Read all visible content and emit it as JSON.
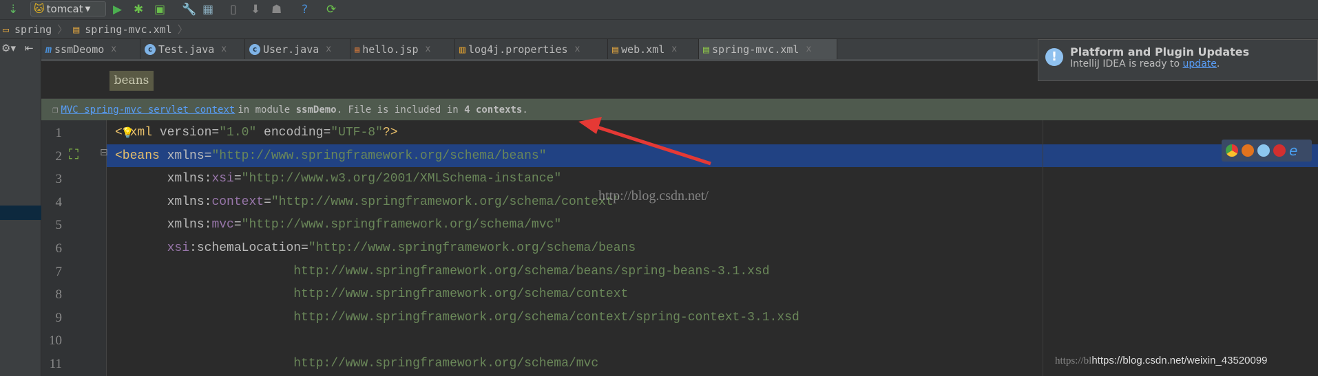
{
  "toolbar": {
    "run_config": "tomcat",
    "icons": [
      "vcs-update-icon",
      "tomcat-icon",
      "run-icon",
      "debug-icon",
      "coverage-icon",
      "settings-icon",
      "project-structure-icon",
      "device-icon",
      "sdk-manager-icon",
      "android-icon",
      "help-icon",
      "sync-icon"
    ]
  },
  "breadcrumb": {
    "items": [
      "spring",
      "spring-mvc.xml"
    ]
  },
  "tabs": [
    {
      "label": "ssmDeomo",
      "icon": "m"
    },
    {
      "label": "Test.java",
      "icon": "c"
    },
    {
      "label": "User.java",
      "icon": "c"
    },
    {
      "label": "hello.jsp",
      "icon": "jsp"
    },
    {
      "label": "log4j.properties",
      "icon": "properties"
    },
    {
      "label": "web.xml",
      "icon": "xml"
    },
    {
      "label": "spring-mvc.xml",
      "icon": "xml",
      "active": true
    }
  ],
  "xml_breadcrumb": "beans",
  "infobar": {
    "link": "MVC spring-mvc servlet context",
    "text_before": "in module ",
    "module": "ssmDemo",
    "text_mid": ". File is included in ",
    "count": "4 contexts",
    "text_end": "."
  },
  "notification": {
    "title": "Platform and Plugin Updates",
    "body": "IntelliJ IDEA is ready to ",
    "link": "update",
    "end": "."
  },
  "code": {
    "line_numbers": [
      "1",
      "2",
      "3",
      "4",
      "5",
      "6",
      "7",
      "8",
      "9",
      "10",
      "11"
    ],
    "lines": [
      [
        [
          "tag",
          "<?xml "
        ],
        [
          "attr",
          "version="
        ],
        [
          "val",
          "\"1.0\""
        ],
        [
          "attr",
          " encoding="
        ],
        [
          "val",
          "\"UTF-8\""
        ],
        [
          "tag",
          "?>"
        ]
      ],
      [
        [
          "tag",
          "<beans "
        ],
        [
          "attr",
          "xmlns="
        ],
        [
          "val",
          "\"http://www.springframework.org/schema/beans\""
        ]
      ],
      [
        [
          "attr",
          "       xmlns:"
        ],
        [
          "ns",
          "xsi"
        ],
        [
          "attr",
          "="
        ],
        [
          "val",
          "\"http://www.w3.org/2001/XMLSchema-instance\""
        ]
      ],
      [
        [
          "attr",
          "       xmlns:"
        ],
        [
          "ns",
          "context"
        ],
        [
          "attr",
          "="
        ],
        [
          "val",
          "\"http://www.springframework.org/schema/context\""
        ]
      ],
      [
        [
          "attr",
          "       xmlns:"
        ],
        [
          "ns",
          "mvc"
        ],
        [
          "attr",
          "="
        ],
        [
          "val",
          "\"http://www.springframework.org/schema/mvc\""
        ]
      ],
      [
        [
          "ns",
          "       xsi"
        ],
        [
          "attr",
          ":schemaLocation="
        ],
        [
          "val",
          "\"http://www.springframework.org/schema/beans"
        ]
      ],
      [
        [
          "val",
          "                        http://www.springframework.org/schema/beans/spring-beans-3.1.xsd"
        ]
      ],
      [
        [
          "val",
          "                        http://www.springframework.org/schema/context"
        ]
      ],
      [
        [
          "val",
          "                        http://www.springframework.org/schema/context/spring-context-3.1.xsd"
        ]
      ],
      [],
      [
        [
          "val",
          "                        http://www.springframework.org/schema/mvc"
        ]
      ]
    ]
  },
  "watermark": {
    "center": "http://blog.csdn.net/",
    "ghost": "https://bl",
    "corner": "https://blog.csdn.net/weixin_43520099"
  },
  "colors": {
    "highlight": "#214283",
    "arrow": "#e53935",
    "infobar": "#4f5a4e"
  }
}
